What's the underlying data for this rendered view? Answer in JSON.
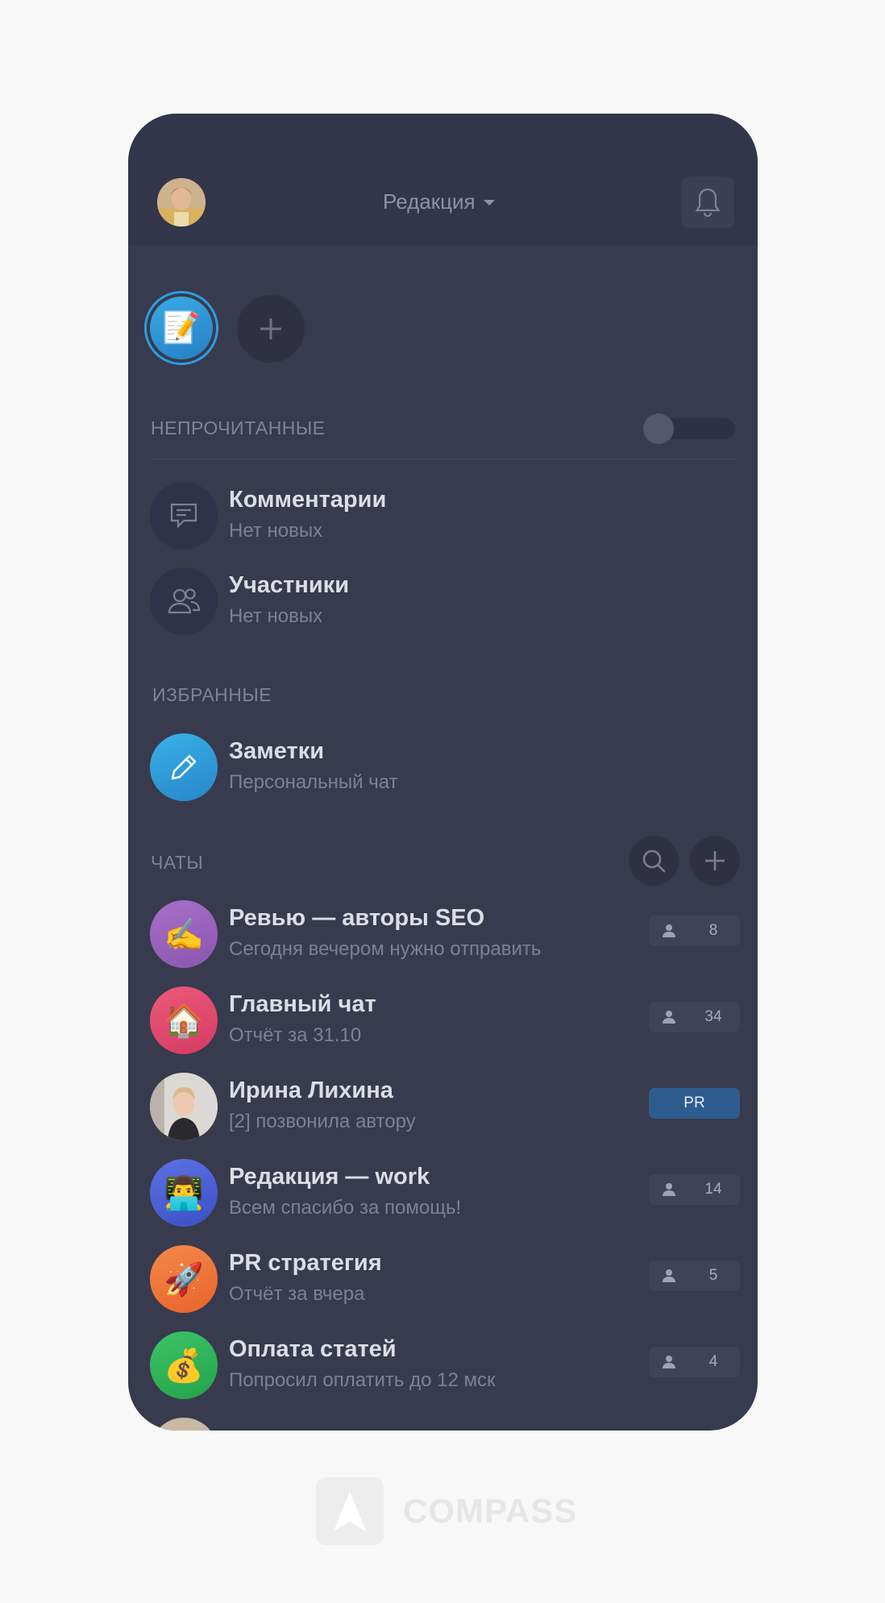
{
  "header": {
    "workspace_title": "Редакция",
    "avatar": "user-avatar",
    "bell_icon": "bell-icon"
  },
  "workspaces": {
    "active_icon": "memo-emoji",
    "active_emoji": "📝",
    "add_icon": "plus-icon"
  },
  "unread": {
    "label": "НЕПРОЧИТАННЫЕ",
    "toggle_on": false,
    "items": [
      {
        "title": "Комментарии",
        "subtitle": "Нет новых",
        "icon": "comment-icon"
      },
      {
        "title": "Участники",
        "subtitle": "Нет новых",
        "icon": "people-icon"
      }
    ]
  },
  "favorites": {
    "label": "ИЗБРАННЫЕ",
    "items": [
      {
        "title": "Заметки",
        "subtitle": "Персональный чат",
        "icon": "pencil-icon"
      }
    ]
  },
  "chats": {
    "label": "ЧАТЫ",
    "search_icon": "search-icon",
    "add_icon": "plus-icon",
    "items": [
      {
        "title": "Ревью — авторы SEO",
        "subtitle": "Сегодня вечером нужно отправить",
        "emoji": "✍️",
        "badge": "8",
        "badge_type": "members"
      },
      {
        "title": "Главный чат",
        "subtitle": "Отчёт за 31.10",
        "emoji": "🏠",
        "badge": "34",
        "badge_type": "members"
      },
      {
        "title": "Ирина Лихина",
        "subtitle": "[2] позвонила автору",
        "emoji": "",
        "badge": "PR",
        "badge_type": "tag"
      },
      {
        "title": "Редакция — work",
        "subtitle": "Всем спасибо за помощь!",
        "emoji": "👨‍💻",
        "badge": "14",
        "badge_type": "members"
      },
      {
        "title": "PR стратегия",
        "subtitle": "Отчёт за вчера",
        "emoji": "🚀",
        "badge": "5",
        "badge_type": "members"
      },
      {
        "title": "Оплата статей",
        "subtitle": "Попросил оплатить до 12 мск",
        "emoji": "💰",
        "badge": "4",
        "badge_type": "members"
      }
    ]
  },
  "colors": {
    "background": "#f8f8f8",
    "panel": "#383a4d",
    "topbar": "#33354a",
    "accent": "#2d9ee0",
    "pr_badge": "#2f5c8f"
  },
  "brand": {
    "name": "COMPASS",
    "logo_icon": "compass-logo-icon"
  }
}
